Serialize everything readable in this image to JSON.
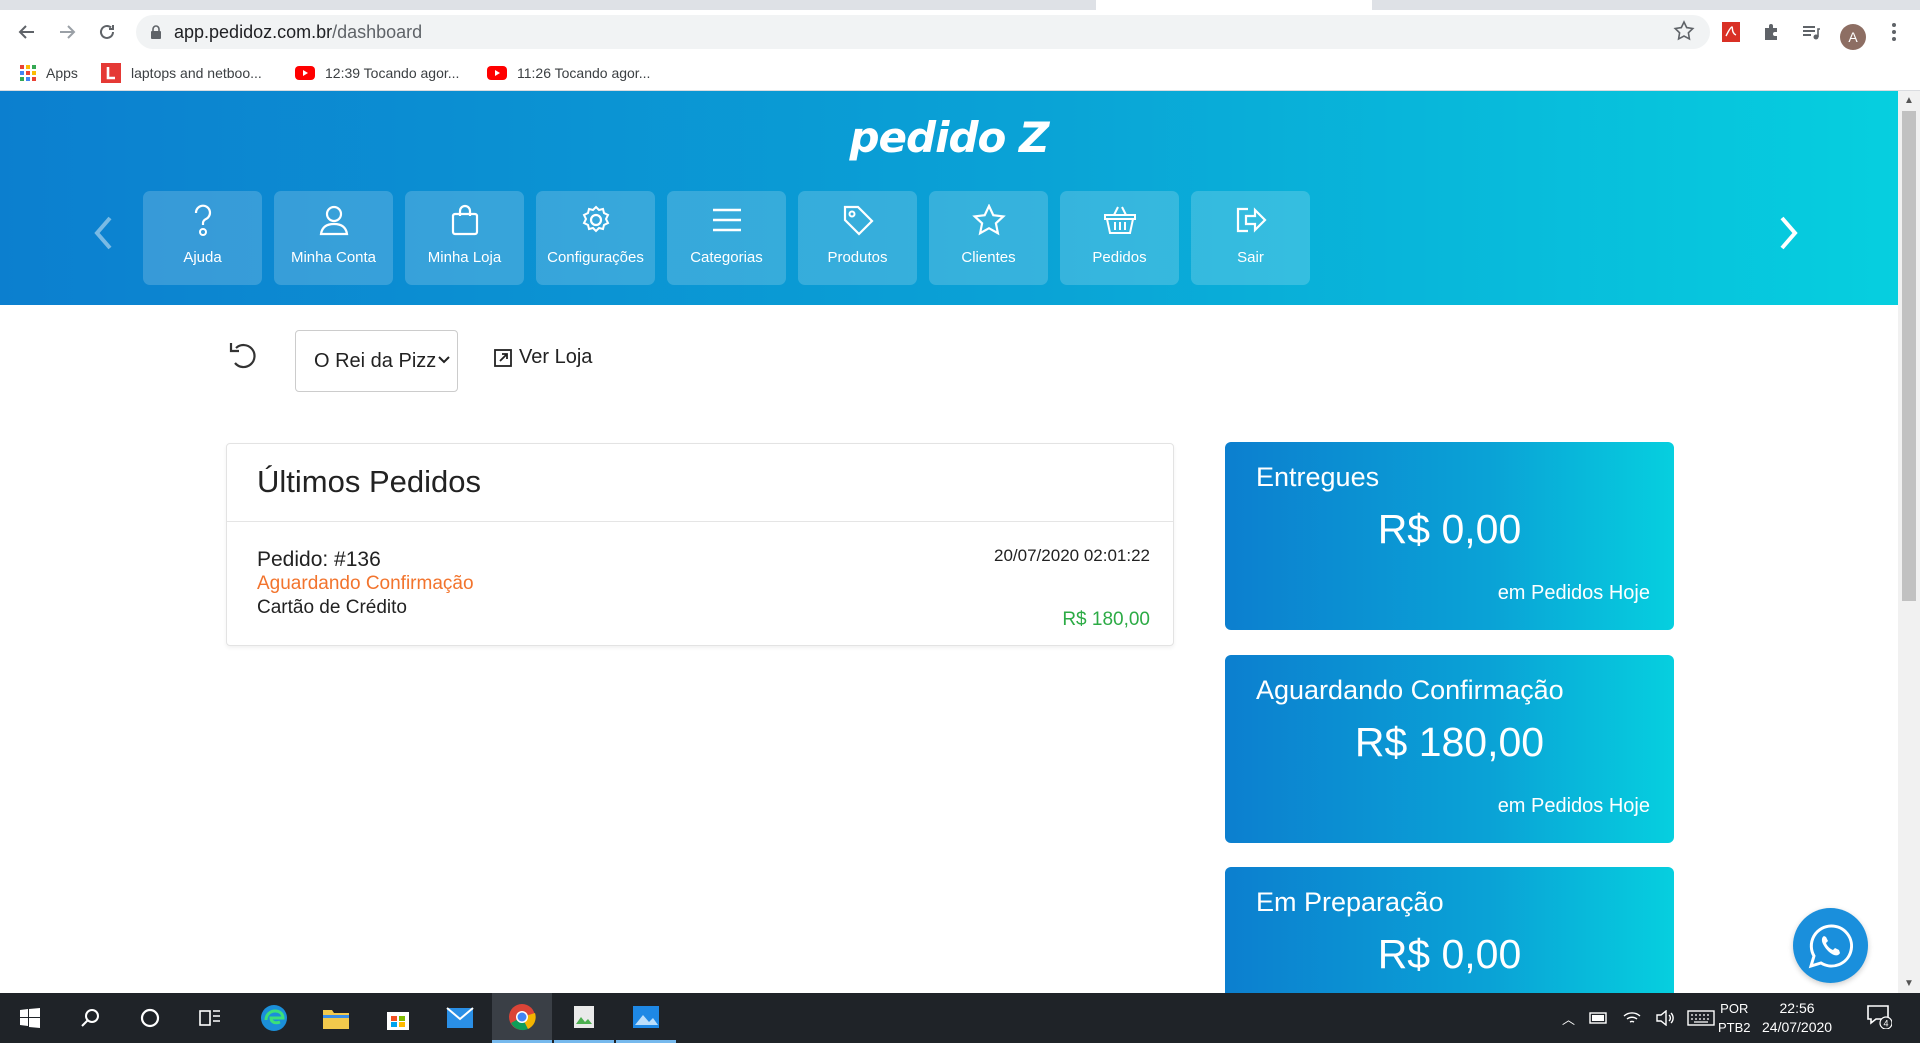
{
  "browser": {
    "url_host": "app.pedidoz.com.br",
    "url_path": "/dashboard",
    "avatar_letter": "A",
    "bookmarks": [
      {
        "label": "Apps",
        "icon": "apps-grid-icon"
      },
      {
        "label": "laptops and netboo...",
        "icon": "l-logo-icon"
      },
      {
        "label": "12:39 Tocando agor...",
        "icon": "youtube-icon"
      },
      {
        "label": "11:26 Tocando agor...",
        "icon": "youtube-icon"
      }
    ]
  },
  "header": {
    "logo": "pedido Z",
    "menu": [
      {
        "label": "Ajuda",
        "icon": "help-icon"
      },
      {
        "label": "Minha Conta",
        "icon": "user-icon"
      },
      {
        "label": "Minha Loja",
        "icon": "shopping-bag-icon"
      },
      {
        "label": "Configurações",
        "icon": "gear-icon"
      },
      {
        "label": "Categorias",
        "icon": "list-icon"
      },
      {
        "label": "Produtos",
        "icon": "tag-icon"
      },
      {
        "label": "Clientes",
        "icon": "star-icon"
      },
      {
        "label": "Pedidos",
        "icon": "basket-icon"
      },
      {
        "label": "Sair",
        "icon": "logout-icon"
      }
    ]
  },
  "toolbar": {
    "store_selected": "O Rei da Pizza",
    "view_store_label": "Ver Loja"
  },
  "orders": {
    "title": "Últimos Pedidos",
    "items": [
      {
        "id": "Pedido: #136",
        "status": "Aguardando Confirmação",
        "payment": "Cartão de Crédito",
        "datetime": "20/07/2020 02:01:22",
        "total": "R$ 180,00"
      }
    ]
  },
  "stats": [
    {
      "title": "Entregues",
      "value": "R$ 0,00",
      "footer": "em Pedidos Hoje"
    },
    {
      "title": "Aguardando Confirmação",
      "value": "R$ 180,00",
      "footer": "em Pedidos Hoje"
    },
    {
      "title": "Em Preparação",
      "value": "R$ 0,00",
      "footer": ""
    }
  ],
  "colors": {
    "brand_blue": "#0c7fcf",
    "brand_cyan": "#06cfdf",
    "status_pending": "#f2742d",
    "total_green": "#2cab45"
  },
  "taskbar": {
    "lang_top": "POR",
    "lang_bottom": "PTB2",
    "time": "22:56",
    "date": "24/07/2020",
    "notification_count": "4"
  }
}
